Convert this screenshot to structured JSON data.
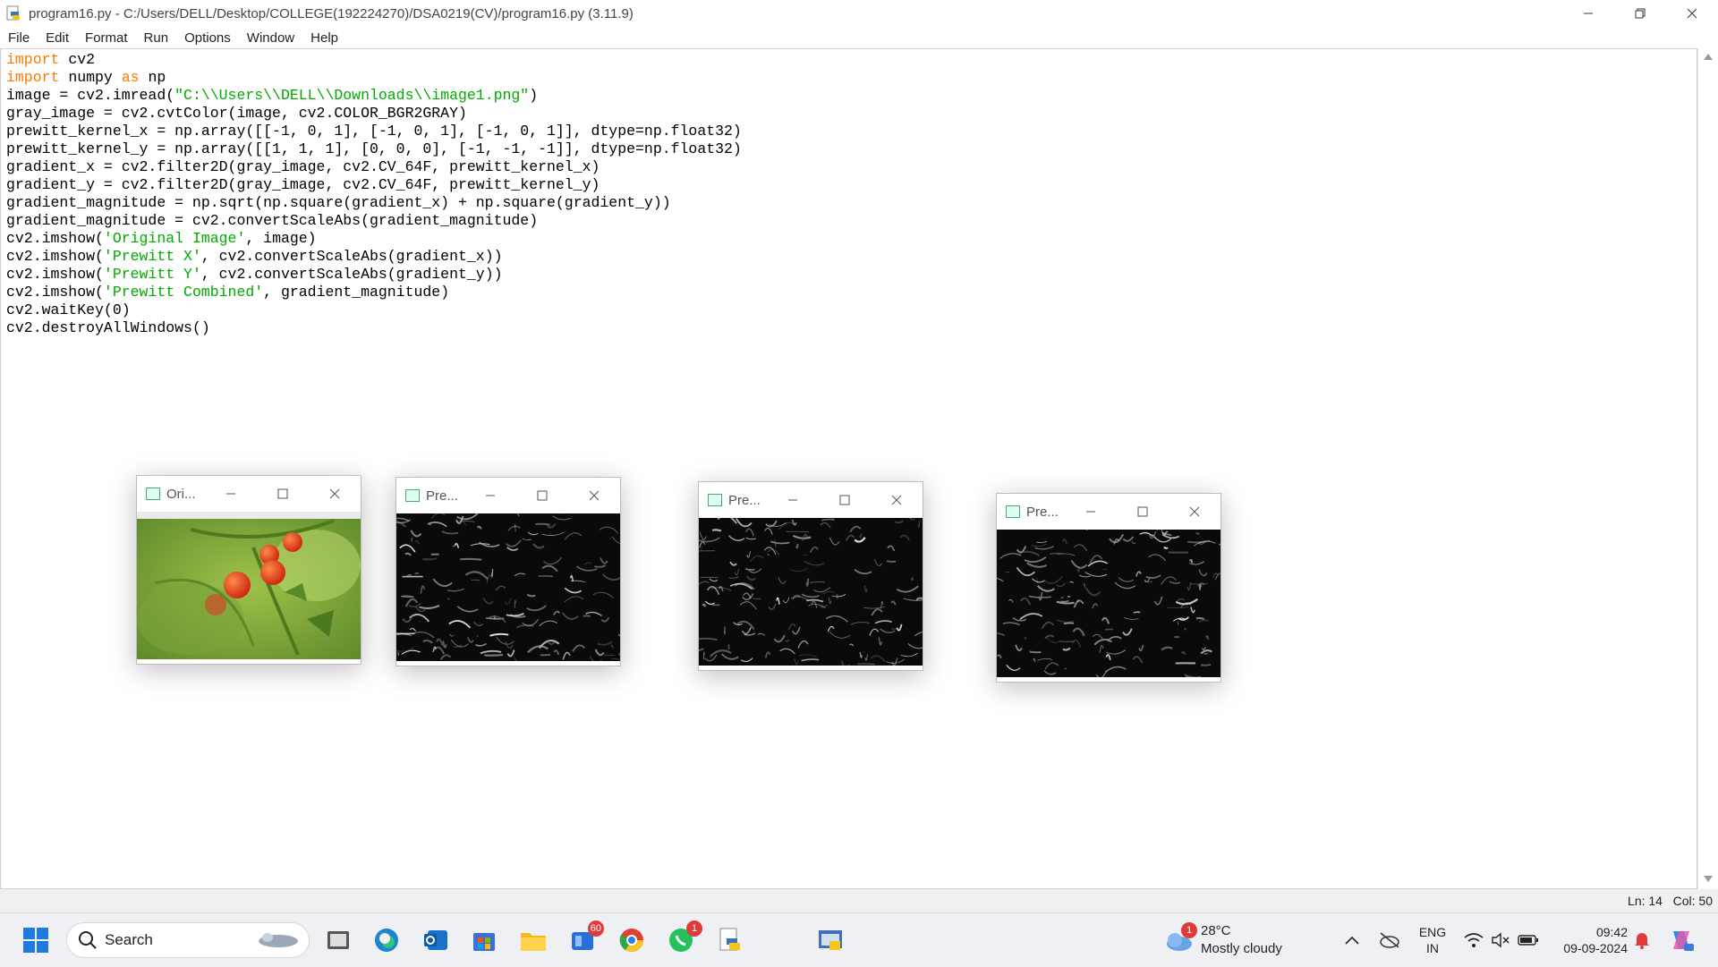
{
  "window": {
    "title": "program16.py - C:/Users/DELL/Desktop/COLLEGE(192224270)/DSA0219(CV)/program16.py (3.11.9)"
  },
  "menu": [
    "File",
    "Edit",
    "Format",
    "Run",
    "Options",
    "Window",
    "Help"
  ],
  "code_lines": [
    [
      {
        "t": "import",
        "c": "kw"
      },
      {
        "t": " cv2",
        "c": ""
      }
    ],
    [
      {
        "t": "import",
        "c": "kw"
      },
      {
        "t": " numpy ",
        "c": ""
      },
      {
        "t": "as",
        "c": "kw"
      },
      {
        "t": " np",
        "c": ""
      }
    ],
    [
      {
        "t": "image = cv2.imread(",
        "c": ""
      },
      {
        "t": "\"C:\\\\Users\\\\DELL\\\\Downloads\\\\image1.png\"",
        "c": "str"
      },
      {
        "t": ")",
        "c": ""
      }
    ],
    [
      {
        "t": "gray_image = cv2.cvtColor(image, cv2.COLOR_BGR2GRAY)",
        "c": ""
      }
    ],
    [
      {
        "t": "prewitt_kernel_x = np.array([[-1, 0, 1], [-1, 0, 1], [-1, 0, 1]], dtype=np.float32)",
        "c": ""
      }
    ],
    [
      {
        "t": "prewitt_kernel_y = np.array([[1, 1, 1], [0, 0, 0], [-1, -1, -1]], dtype=np.float32)",
        "c": ""
      }
    ],
    [
      {
        "t": "gradient_x = cv2.filter2D(gray_image, cv2.CV_64F, prewitt_kernel_x)",
        "c": ""
      }
    ],
    [
      {
        "t": "gradient_y = cv2.filter2D(gray_image, cv2.CV_64F, prewitt_kernel_y)",
        "c": ""
      }
    ],
    [
      {
        "t": "gradient_magnitude = np.sqrt(np.square(gradient_x) + np.square(gradient_y))",
        "c": ""
      }
    ],
    [
      {
        "t": "gradient_magnitude = cv2.convertScaleAbs(gradient_magnitude)",
        "c": ""
      }
    ],
    [
      {
        "t": "cv2.imshow(",
        "c": ""
      },
      {
        "t": "'Original Image'",
        "c": "str"
      },
      {
        "t": ", image)",
        "c": ""
      }
    ],
    [
      {
        "t": "cv2.imshow(",
        "c": ""
      },
      {
        "t": "'Prewitt X'",
        "c": "str"
      },
      {
        "t": ", cv2.convertScaleAbs(gradient_x))",
        "c": ""
      }
    ],
    [
      {
        "t": "cv2.imshow(",
        "c": ""
      },
      {
        "t": "'Prewitt Y'",
        "c": "str"
      },
      {
        "t": ", cv2.convertScaleAbs(gradient_y))",
        "c": ""
      }
    ],
    [
      {
        "t": "cv2.imshow(",
        "c": ""
      },
      {
        "t": "'Prewitt Combined'",
        "c": "str"
      },
      {
        "t": ", gradient_magnitude)",
        "c": ""
      }
    ],
    [
      {
        "t": "cv2.waitKey(0)",
        "c": ""
      }
    ],
    [
      {
        "t": "cv2.destroyAllWindows()",
        "c": ""
      }
    ]
  ],
  "status": {
    "line": "Ln: 14",
    "col": "Col: 50"
  },
  "cv_windows": [
    {
      "title": "Ori...",
      "kind": "original"
    },
    {
      "title": "Pre...",
      "kind": "edges"
    },
    {
      "title": "Pre...",
      "kind": "edges"
    },
    {
      "title": "Pre...",
      "kind": "edges"
    }
  ],
  "taskbar": {
    "search_label": "Search",
    "store_badge": "60",
    "whatsapp_badge": "1",
    "weather_badge": "1",
    "temperature": "28°C",
    "weather_desc": "Mostly cloudy",
    "lang_top": "ENG",
    "lang_bottom": "IN",
    "time": "09:42",
    "date": "09-09-2024"
  },
  "colors": {
    "keyword": "#ff7700",
    "string": "#00aa00",
    "badge": "#e03b3b"
  }
}
